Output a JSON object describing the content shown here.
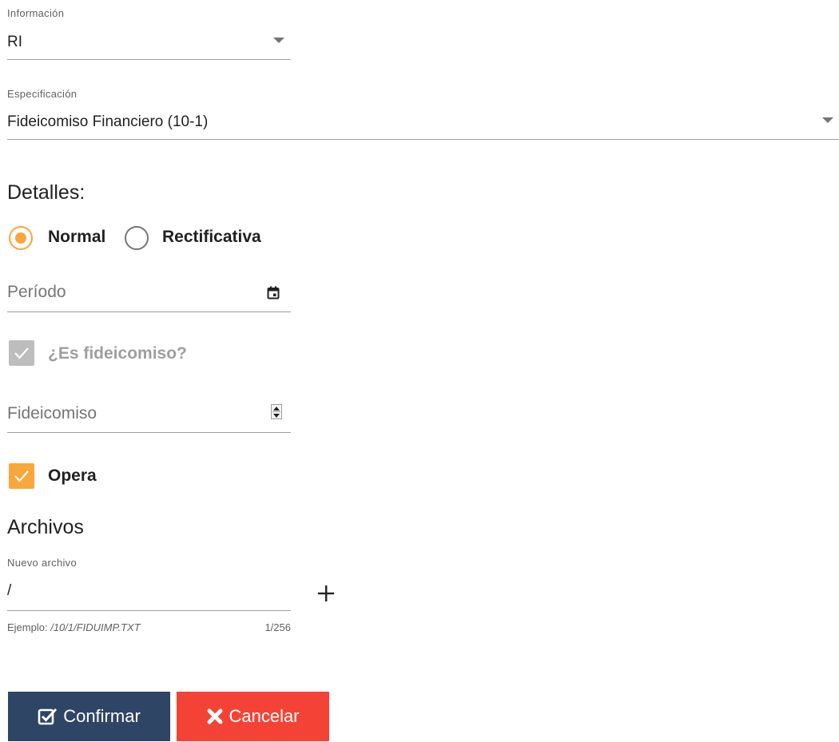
{
  "informacion": {
    "label": "Información",
    "value": "RI"
  },
  "especificacion": {
    "label": "Especificación",
    "value": "Fideicomiso Financiero (10-1)"
  },
  "detalles": {
    "title": "Detalles:",
    "radios": [
      {
        "label": "Normal",
        "checked": true
      },
      {
        "label": "Rectificativa",
        "checked": false
      }
    ],
    "periodo_placeholder": "Período",
    "es_fideicomiso": {
      "label": "¿Es fideicomiso?",
      "checked": true,
      "disabled": true
    },
    "fideicomiso_placeholder": "Fideicomiso",
    "opera": {
      "label": "Opera",
      "checked": true
    }
  },
  "archivos": {
    "title": "Archivos",
    "nuevo_label": "Nuevo archivo",
    "nuevo_value": "/",
    "hint_prefix": "Ejemplo: ",
    "hint_example": "/10/1/FIDUIMP.TXT",
    "counter": "1/256"
  },
  "buttons": {
    "confirm": "Confirmar",
    "cancel": "Cancelar"
  },
  "colors": {
    "accent": "#f9a63a",
    "confirm_bg": "#2f4566",
    "cancel_bg": "#f44336"
  }
}
